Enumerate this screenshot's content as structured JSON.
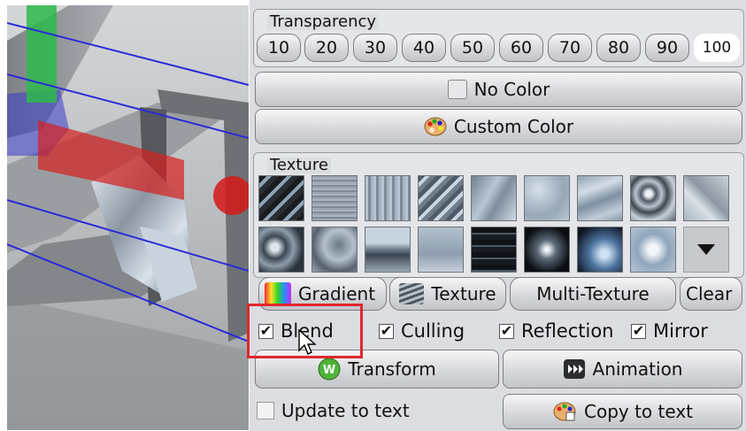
{
  "transparency": {
    "title": "Transparency",
    "values": [
      "10",
      "20",
      "30",
      "40",
      "50",
      "60",
      "70",
      "80",
      "90",
      "100"
    ],
    "selected": "100"
  },
  "color": {
    "no_color_label": "No Color",
    "custom_color_label": "Custom Color"
  },
  "texture": {
    "title": "Texture",
    "swatches": [
      {
        "name": "diagonal-dark"
      },
      {
        "name": "brushed-horizontal"
      },
      {
        "name": "brushed-vertical"
      },
      {
        "name": "diagonal-light"
      },
      {
        "name": "scratched-steel"
      },
      {
        "name": "frosted"
      },
      {
        "name": "wave-steel"
      },
      {
        "name": "crumpled-chrome"
      },
      {
        "name": "marble-grey"
      },
      {
        "name": "liquid-dark"
      },
      {
        "name": "hammered"
      },
      {
        "name": "horizon-reflection"
      },
      {
        "name": "soft-gradient"
      },
      {
        "name": "dark-stripes"
      },
      {
        "name": "radial-dark"
      },
      {
        "name": "radial-blue"
      },
      {
        "name": "radial-light"
      }
    ],
    "more_icon": "down-triangle-icon"
  },
  "material_buttons": {
    "gradient_label": "Gradient",
    "texture_label": "Texture",
    "multi_texture_label": "Multi-Texture",
    "clear_label": "Clear"
  },
  "options": {
    "blend": {
      "label": "Blend",
      "checked": true
    },
    "culling": {
      "label": "Culling",
      "checked": true
    },
    "reflection": {
      "label": "Reflection",
      "checked": true
    },
    "mirror": {
      "label": "Mirror",
      "checked": true
    }
  },
  "actions": {
    "transform_label": "Transform",
    "animation_label": "Animation",
    "update_to_text_label": "Update to text",
    "update_to_text_checked": false,
    "copy_to_text_label": "Copy to text"
  },
  "colors": {
    "highlight": "#e0282d",
    "panel": "#dcdde0",
    "bounding_box": "#2a2ad8"
  }
}
